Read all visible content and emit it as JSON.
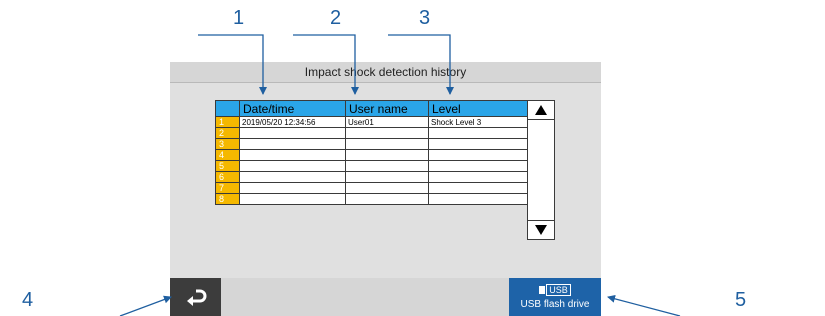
{
  "callouts": [
    "1",
    "2",
    "3",
    "4",
    "5"
  ],
  "title": "Impact shock detection history",
  "table": {
    "headers": [
      "Date/time",
      "User name",
      "Level"
    ],
    "rows": [
      {
        "num": "1",
        "datetime": "2019/05/20  12:34:56",
        "user": "User01",
        "level": "Shock Level 3"
      },
      {
        "num": "2",
        "datetime": "",
        "user": "",
        "level": ""
      },
      {
        "num": "3",
        "datetime": "",
        "user": "",
        "level": ""
      },
      {
        "num": "4",
        "datetime": "",
        "user": "",
        "level": ""
      },
      {
        "num": "5",
        "datetime": "",
        "user": "",
        "level": ""
      },
      {
        "num": "6",
        "datetime": "",
        "user": "",
        "level": ""
      },
      {
        "num": "7",
        "datetime": "",
        "user": "",
        "level": ""
      },
      {
        "num": "8",
        "datetime": "",
        "user": "",
        "level": ""
      }
    ]
  },
  "scroll": {
    "up_icon": "triangle-up",
    "down_icon": "triangle-down"
  },
  "footer": {
    "back_icon": "return-arrow",
    "usb_badge": "USB",
    "usb_label": "USB flash drive"
  },
  "colors": {
    "callout": "#1f5fa0",
    "header_bg": "#2aa5e8",
    "row_number_bg": "#f5b800",
    "usb_button_bg": "#1e63a8",
    "back_button_bg": "#3c3c3c"
  }
}
